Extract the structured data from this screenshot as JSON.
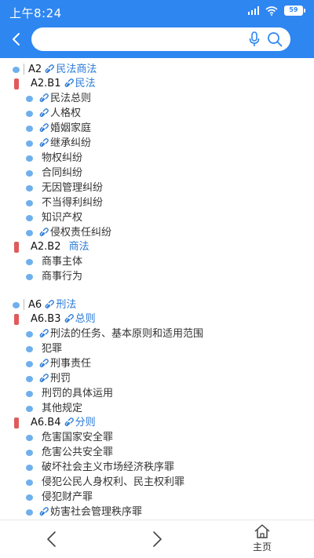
{
  "status": {
    "time": "上午8:24",
    "battery": "59"
  },
  "search": {
    "value": "",
    "placeholder": ""
  },
  "colors": {
    "header": "#2e86f0",
    "link": "#2a7ad6",
    "dot": "#6fb0ec",
    "marker": "#e05a5a"
  },
  "tree": {
    "a2": {
      "code": "A2",
      "title": "民法商法"
    },
    "a2b1": {
      "code": "A2.B1",
      "title": "民法"
    },
    "a2b1_items": [
      "民法总则",
      "人格权",
      "婚姻家庭",
      "继承纠纷",
      "物权纠纷",
      "合同纠纷",
      "无因管理纠纷",
      "不当得利纠纷",
      "知识产权",
      "侵权责任纠纷"
    ],
    "a2b2": {
      "code": "A2.B2",
      "title": "商法"
    },
    "a2b2_items": [
      "商事主体",
      "商事行为"
    ],
    "a6": {
      "code": "A6",
      "title": "刑法"
    },
    "a6b3": {
      "code": "A6.B3",
      "title": "总则"
    },
    "a6b3_items": [
      "刑法的任务、基本原则和适用范围",
      "犯罪",
      "刑事责任",
      "刑罚",
      "刑罚的具体运用",
      "其他规定"
    ],
    "a6b4": {
      "code": "A6.B4",
      "title": "分则"
    },
    "a6b4_items": [
      "危害国家安全罪",
      "危害公共安全罪",
      "破坏社会主义市场经济秩序罪",
      "侵犯公民人身权利、民主权利罪",
      "侵犯财产罪",
      "妨害社会管理秩序罪"
    ]
  },
  "nav": {
    "home_label": "主页"
  }
}
